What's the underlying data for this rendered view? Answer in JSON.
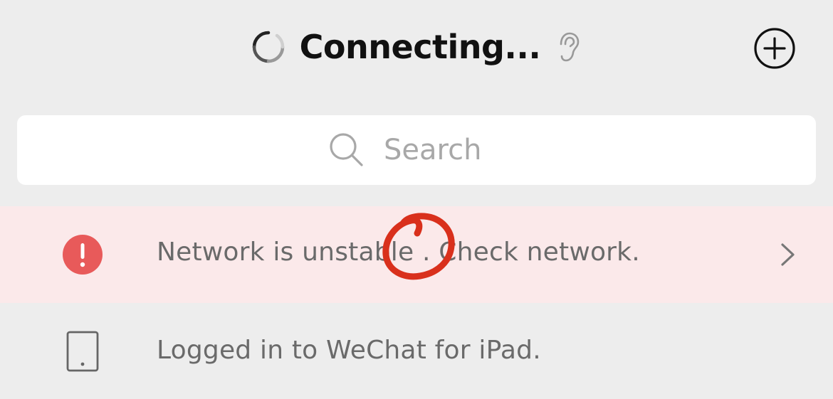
{
  "header": {
    "title": "Connecting...",
    "icons": {
      "spinner": "loading-spinner-icon",
      "ear": "ear-icon",
      "add": "plus-circle-icon"
    }
  },
  "search": {
    "placeholder": "Search",
    "icon": "search-icon"
  },
  "network_banner": {
    "message": "Network is unstable . Check network.",
    "icon": "exclamation-circle-icon",
    "icon_color": "#e85a5a",
    "background": "#fbe9ea",
    "annotation": "red-hand-drawn-circle"
  },
  "device_banner": {
    "message": "Logged in to WeChat for iPad.",
    "icon": "tablet-icon"
  },
  "colors": {
    "background": "#ededed",
    "text_primary": "#111111",
    "text_secondary": "#6a6a6a",
    "placeholder": "#a8a8a8",
    "annotation_red": "#d9301c"
  }
}
